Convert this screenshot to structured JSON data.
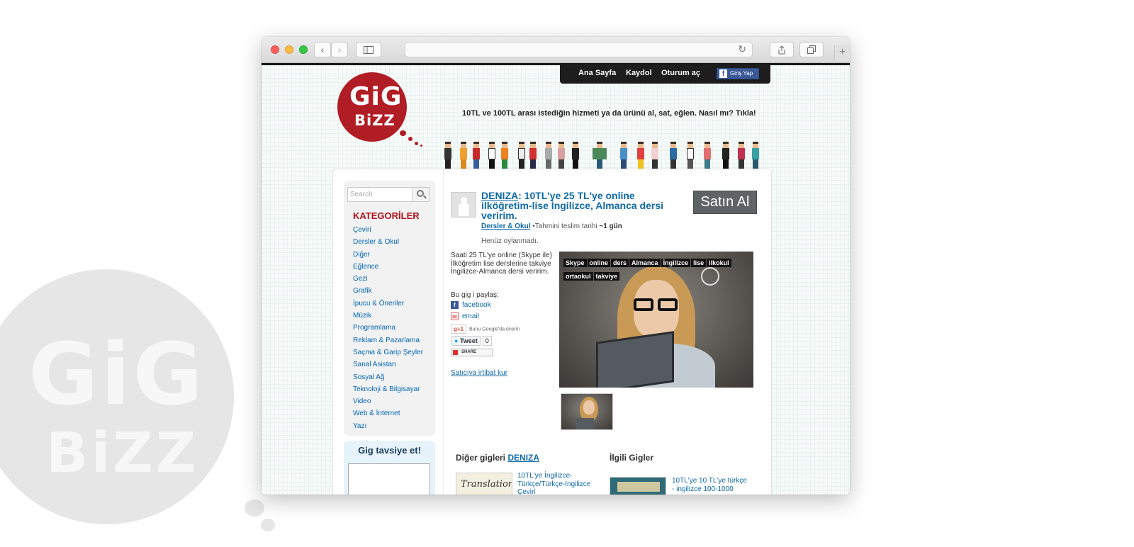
{
  "background": {
    "logo_top": "GiG",
    "logo_bottom": "BiZZ"
  },
  "browser": {
    "url": ""
  },
  "site": {
    "logo_top": "GiG",
    "logo_bottom": "BiZZ",
    "tagline": "10TL ve 100TL arası istediğin hizmeti ya da ürünü al, sat, eğlen. Nasıl mı? Tıkla!",
    "nav": {
      "home": "Ana Sayfa",
      "register": "Kaydol",
      "login": "Oturum aç",
      "facebook_login": "Giriş Yap"
    }
  },
  "sidebar": {
    "search_placeholder": "Search",
    "categories_title": "KATEGORİLER",
    "categories": [
      "Çeviri",
      "Dersler & Okul",
      "Diğer",
      "Eğlence",
      "Gezi",
      "Grafik",
      "İpucu & Öneriler",
      "Müzik",
      "Programlama",
      "Reklam & Pazarlama",
      "Saçma & Garip Şeyler",
      "Sanal Asistan",
      "Sosyal Ağ",
      "Teknoloji & Bilgisayar",
      "Video",
      "Web & İnternet",
      "Yazı"
    ],
    "recommend_title": "Gig tavsiye et!"
  },
  "gig": {
    "seller": "DENIZA",
    "title": ": 10TL'ye 25 TL'ye online ilköğretim-lise İngilizce, Almanca dersi veririm.",
    "buy_label": "Satın Al",
    "category": "Dersler & Okul",
    "delivery_prefix": "•Tahmini teslim tarihi ",
    "delivery_value": "~1 gün",
    "rating": "Henüz oylanmadı.",
    "description": "Saati 25 TL'ye online (Skype ile) İlköğretim lise derslerine takviye İngilizce-Almanca dersi veririm.",
    "share_label": "Bu gig i paylaş:",
    "share_facebook": "facebook",
    "share_email": "email",
    "gplus_label": "Bunu Google'da önerin",
    "gplus_button": "g+1",
    "tweet_label": "Tweet",
    "tweet_count": "0",
    "share_button": "SHARE",
    "contact_seller": "Satıcıya irtibat kur",
    "tags": [
      "Skype",
      "online",
      "ders",
      "Almanca",
      "İngilizce",
      "lise",
      "ilkokul",
      "ortaokul",
      "takviye"
    ]
  },
  "other_gigs": {
    "heading_prefix": "Diğer gigleri ",
    "seller": "DENIZA",
    "items": [
      {
        "title": "10TL'ye İngilizce-Türkçe/Türkçe-İngilizce Çeviri",
        "thumb_text": "Translation"
      }
    ]
  },
  "related_gigs": {
    "heading": "İlgili Gigler",
    "items": [
      {
        "title": "10TL'ye 10 TL'ye türkçe - ingilizce 100-1000"
      }
    ]
  }
}
